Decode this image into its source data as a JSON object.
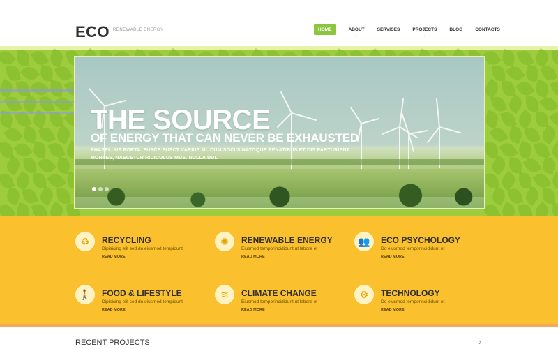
{
  "header": {
    "logo": "ECO",
    "tagline": "RENEWABLE ENERGY",
    "nav": [
      {
        "label": "HOME",
        "active": true,
        "caret": false
      },
      {
        "label": "ABOUT",
        "active": false,
        "caret": true
      },
      {
        "label": "SERVICES",
        "active": false,
        "caret": false
      },
      {
        "label": "PROJECTS",
        "active": false,
        "caret": true
      },
      {
        "label": "BLOG",
        "active": false,
        "caret": false
      },
      {
        "label": "CONTACTS",
        "active": false,
        "caret": false
      }
    ]
  },
  "hero": {
    "title": "THE SOURCE",
    "subtitle": "OF ENERGY THAT CAN NEVER BE EXHAUSTED",
    "description": "PHASELLUS PORTA. FUSCE SUSCT VARIUS MI. CUM SOCIIS NATOQUE PENATIBUS ET DIS PARTURIENT MONTES, NASCETUR RIDICULUS MUS. NULLA DUI.",
    "slides": 3,
    "active_slide": 0
  },
  "services": [
    {
      "title": "RECYCLING",
      "text": "Dipisicing elit sed do eiusmod tempidunt",
      "more": "READ MORE",
      "icon": "recycle-icon",
      "glyph": "♻"
    },
    {
      "title": "RENEWABLE ENERGY",
      "text": "Eiusmod temporincididunt ut labore et",
      "more": "READ MORE",
      "icon": "sun-icon",
      "glyph": "✺"
    },
    {
      "title": "ECO PSYCHOLOGY",
      "text": "Do eiusmod temporincididunt ut",
      "more": "READ MORE",
      "icon": "people-icon",
      "glyph": "👥"
    },
    {
      "title": "FOOD & LIFESTYLE",
      "text": "Dipisicing elit sed do eiusmod tempidunt",
      "more": "READ MORE",
      "icon": "walking-person-icon",
      "glyph": "🚶"
    },
    {
      "title": "CLIMATE CHANGE",
      "text": "Eiusmod temporincididunt ut labore et",
      "more": "READ MORE",
      "icon": "waves-icon",
      "glyph": "≋"
    },
    {
      "title": "TECHNOLOGY",
      "text": "Do eiusmod temporincididunt ut",
      "more": "READ MORE",
      "icon": "gears-icon",
      "glyph": "⚙"
    }
  ],
  "recent": {
    "title": "RECENT PROJECTS",
    "arrow": "›"
  },
  "colors": {
    "accent_green": "#8cc63f",
    "hero_green": "#9dcc3f",
    "services_yellow": "#fbc02d"
  }
}
